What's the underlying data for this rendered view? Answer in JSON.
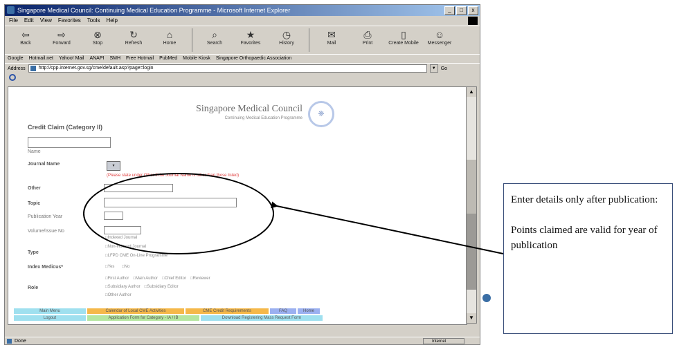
{
  "browser": {
    "title": "Singapore Medical Council: Continuing Medical Education Programme - Microsoft Internet Explorer",
    "window_buttons": [
      "_",
      "□",
      "x"
    ],
    "menu": [
      "File",
      "Edit",
      "View",
      "Favorites",
      "Tools",
      "Help"
    ],
    "toolbar": [
      "Back",
      "Forward",
      "Stop",
      "Refresh",
      "Home",
      "Search",
      "Favorites",
      "History",
      "Mail",
      "Print",
      "Create Mobile",
      "Messenger"
    ],
    "links": [
      "Google",
      "Hotmail.net",
      "Yahoo! Mail",
      "ANAPI",
      "SMH",
      "Free Hotmail",
      "PubMed",
      "Mobile Kiosk",
      "Singapore Orthopaedic Association"
    ],
    "address_label": "Address",
    "address": "http://cpp.internet.gov.sg/cme/default.asp?page=login",
    "go_label": "Go",
    "status": "Done",
    "zone": "Internet"
  },
  "page": {
    "logo_title": "Singapore Medical Council",
    "logo_subtitle": "Continuing Medical Education Programme",
    "heading": "Credit Claim (Category II)",
    "name_label": "Name",
    "journal_label": "Journal Name",
    "journal_select": "▾",
    "journal_note": "(Please state under Other if the Journal Name is other than those listed)",
    "other_label": "Other",
    "topic_label": "Topic",
    "pubyear_label": "Publication Year",
    "volume_label": "Volume/Issue No",
    "type_label": "Type",
    "type_options": [
      "Indexed Journal",
      "Non-indexed Journal",
      "LFPD CME On-Line Programme"
    ],
    "index_label": "Index Medicus*",
    "index_options": [
      "Yes",
      "No"
    ],
    "role_label": "Role",
    "role_row1": [
      "First Author",
      "Main Author",
      "Chief Editor",
      "Reviewer"
    ],
    "role_row2": [
      "Subsidiary Author",
      "Subsidiary Editor"
    ],
    "role_row3": [
      "Other Author"
    ],
    "nav_row1": [
      "Main Menu",
      "Calendar of Local CME Activities",
      "CME Credit Requirements",
      "FAQ",
      "Home"
    ],
    "nav_row2": [
      "Logout",
      "Application Form for Category - IA / IB",
      "Download Registering Mass Request Form"
    ]
  },
  "callout": {
    "line1": "Enter details only after publication:",
    "line2": "Points claimed are valid for year of publication"
  },
  "colors": {
    "nav_orange": "#f5b84a",
    "nav_blue": "#9bb0f0",
    "nav_cyan": "#9fe0ef",
    "nav_green": "#b5e6a0",
    "note_red": "#e04040"
  }
}
